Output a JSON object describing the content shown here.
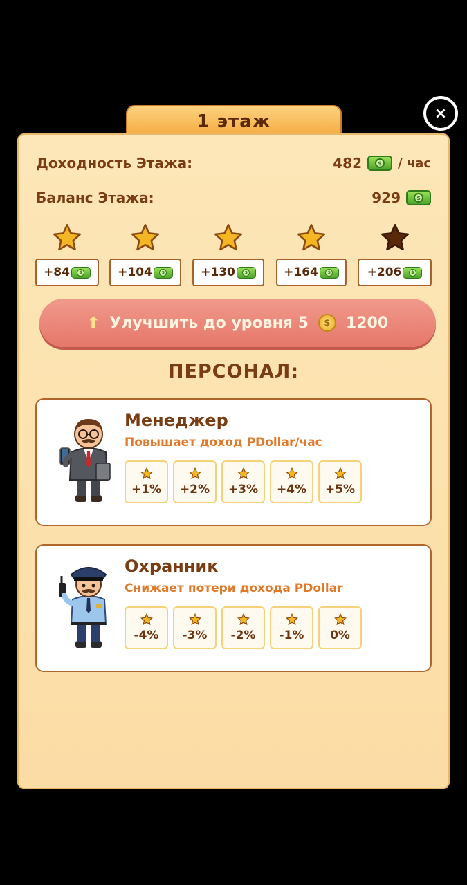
{
  "header": {
    "title": "1 этаж",
    "close_label": "×"
  },
  "stats": {
    "income_label": "Доходность Этажа:",
    "income_value": "482",
    "income_unit": "/ час",
    "balance_label": "Баланс Этажа:",
    "balance_value": "929"
  },
  "star_levels": [
    {
      "bonus": "+84",
      "achieved": true
    },
    {
      "bonus": "+104",
      "achieved": true
    },
    {
      "bonus": "+130",
      "achieved": true
    },
    {
      "bonus": "+164",
      "achieved": true
    },
    {
      "bonus": "+206",
      "achieved": false
    }
  ],
  "upgrade": {
    "label": "Улучшить до уровня 5",
    "cost": "1200"
  },
  "staff": {
    "title": "ПЕРСОНАЛ:",
    "manager": {
      "name": "Менеджер",
      "description": "Повышает доход PDollar/час",
      "levels": [
        "+1%",
        "+2%",
        "+3%",
        "+4%",
        "+5%"
      ]
    },
    "guard": {
      "name": "Охранник",
      "description": "Снижает потери дохода PDollar",
      "levels": [
        "-4%",
        "-3%",
        "-2%",
        "-1%",
        "0%"
      ]
    }
  },
  "colors": {
    "panel": "#fde6b8",
    "tab": "#f5a93e",
    "upgrade_button": "#e5776a",
    "star_gold": "#f5b623",
    "star_dark": "#5a2a08",
    "money_green": "#4ea32a"
  }
}
